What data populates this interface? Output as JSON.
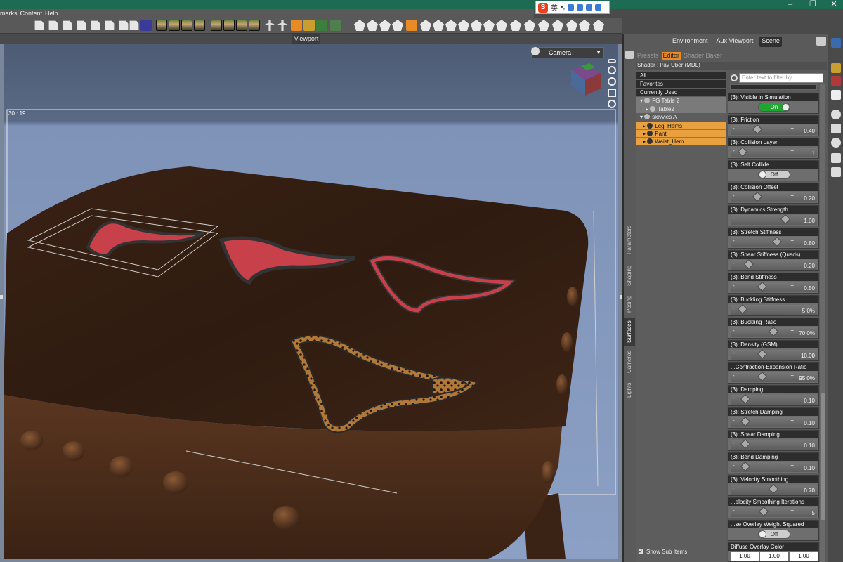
{
  "menu": [
    "marks",
    "Content",
    "Help"
  ],
  "ime": {
    "label": "英",
    "dots": "•,"
  },
  "viewport": {
    "tab": "Viewport",
    "camera": "Camera",
    "coords": "30 : 19"
  },
  "right_tabs": [
    "Environment",
    "Aux Viewport",
    "Scene"
  ],
  "sub_tabs": [
    "Presets",
    "Editor",
    "Shader Baker"
  ],
  "shader": "Shader : Iray Uber (MDL)",
  "vertical_tabs": [
    "Parameters",
    "Shaping",
    "Posing",
    "Surfaces",
    "Cameras",
    "Lights"
  ],
  "tree": [
    {
      "label": "All",
      "style": "dark"
    },
    {
      "label": "Favorites",
      "style": "dark"
    },
    {
      "label": "Currently Used",
      "style": "dark"
    },
    {
      "label": "FG Table 2",
      "style": "grey"
    },
    {
      "label": "Table2",
      "style": "grey"
    },
    {
      "label": "skivvies A",
      "style": "plain"
    },
    {
      "label": "Leg_Hems",
      "style": "org"
    },
    {
      "label": "Pant",
      "style": "org"
    },
    {
      "label": "Waist_Hem",
      "style": "org"
    }
  ],
  "show_sub_items": "Show Sub Items",
  "filter_placeholder": "Enter text to filter by...",
  "params": [
    {
      "label": "(3): Visible in Simulation",
      "kind": "toggle",
      "state": "On"
    },
    {
      "label": "(3): Friction",
      "kind": "slider",
      "value": "0.40",
      "pos": 0.35
    },
    {
      "label": "(3): Collision Layer",
      "kind": "slider",
      "value": "1",
      "pos": 0.05
    },
    {
      "label": "(3): Self Collide",
      "kind": "toggle",
      "state": "Off"
    },
    {
      "label": "(3): Collision Offset",
      "kind": "slider",
      "value": "0.20",
      "pos": 0.35
    },
    {
      "label": "(3): Dynamics Strength",
      "kind": "slider",
      "value": "1.00",
      "pos": 0.93
    },
    {
      "label": "(3): Stretch Stiffness",
      "kind": "slider",
      "value": "0.80",
      "pos": 0.75
    },
    {
      "label": "(3): Shear Stiffness (Quads)",
      "kind": "slider",
      "value": "0.20",
      "pos": 0.18
    },
    {
      "label": "(3): Bend Stiffness",
      "kind": "slider",
      "value": "0.50",
      "pos": 0.45
    },
    {
      "label": "(3): Buckling Stiffness",
      "kind": "slider",
      "value": "5.0%",
      "pos": 0.05
    },
    {
      "label": "(3): Buckling Ratio",
      "kind": "slider",
      "value": "70.0%",
      "pos": 0.68
    },
    {
      "label": "(3): Density (GSM)",
      "kind": "slider",
      "value": "10.00",
      "pos": 0.45,
      "highlight": true
    },
    {
      "label": "...Contraction-Expansion Ratio",
      "kind": "slider",
      "value": "95.0%",
      "pos": 0.45,
      "highlight": true
    },
    {
      "label": "(3): Damping",
      "kind": "slider",
      "value": "0.10",
      "pos": 0.12
    },
    {
      "label": "(3): Stretch Damping",
      "kind": "slider",
      "value": "0.10",
      "pos": 0.12
    },
    {
      "label": "(3): Shear Damping",
      "kind": "slider",
      "value": "0.10",
      "pos": 0.12
    },
    {
      "label": "(3): Bend Damping",
      "kind": "slider",
      "value": "0.10",
      "pos": 0.12
    },
    {
      "label": "(3): Velocity Smoothing",
      "kind": "slider",
      "value": "0.70",
      "pos": 0.68,
      "highlight": true
    },
    {
      "label": "...elocity Smoothing Iterations",
      "kind": "slider",
      "value": "5",
      "pos": 0.48
    },
    {
      "label": "...se Overlay Weight Squared",
      "kind": "toggle",
      "state": "Off"
    }
  ],
  "diffuse": {
    "label": "Diffuse Overlay Color",
    "values": [
      "1.00",
      "1.00",
      "1.00"
    ]
  },
  "colors": {
    "title_bar": "#1d6b53",
    "accent": "#e88a25",
    "toggle_on": "#1fa630",
    "wood": "#3b2417",
    "garment_red": "#c7404a"
  }
}
